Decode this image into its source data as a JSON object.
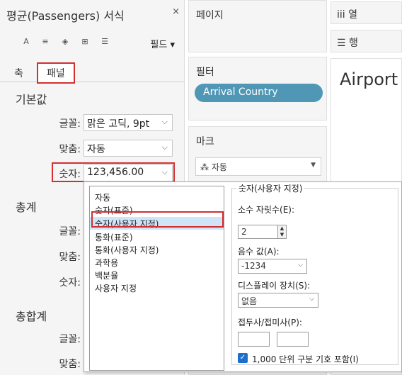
{
  "format_pane": {
    "title": "평균(Passengers) 서식",
    "close_glyph": "×",
    "toolbar": {
      "icons": [
        "font-icon",
        "align-icon",
        "shading-icon",
        "borders-icon",
        "lines-icon"
      ],
      "glyphs": [
        "A",
        "≡",
        "◈",
        "⊞",
        "☰"
      ],
      "fields_label": "필드",
      "fields_caret": "▾"
    },
    "tabs": {
      "axis": "축",
      "panel": "패널"
    },
    "default_section": {
      "title": "기본값",
      "font_label": "글꼴:",
      "font_value": "맑은 고딕, 9pt",
      "align_label": "맞춤:",
      "align_value": "자동",
      "number_label": "숫자:",
      "number_value": "123,456.00"
    },
    "totals_section": {
      "title": "총계",
      "font_label": "글꼴:",
      "align_label": "맞춤:",
      "number_label": "숫자:"
    },
    "grand_totals_section": {
      "title": "총합계",
      "font_label": "글꼴:",
      "align_label": "맞춤:"
    }
  },
  "shelves": {
    "pages": "페이지",
    "filters": "필터",
    "filter_pill": "Arrival Country",
    "marks": "마크",
    "mark_type": "자동",
    "columns": "iii 열",
    "rows": "☰ 행"
  },
  "view": {
    "title": "Airport"
  },
  "number_format_popup": {
    "list_items": [
      "자동",
      "숫자(표준)",
      "숫자(사용자 지정)",
      "통화(표준)",
      "통화(사용자 지정)",
      "과학용",
      "백분율",
      "사용자 지정"
    ],
    "selected_index": 2,
    "group_title": "숫자(사용자 지정)",
    "decimal_label": "소수 자릿수(E):",
    "decimal_value": "2",
    "negative_label": "음수 값(A):",
    "negative_value": "-1234",
    "display_units_label": "디스플레이 장치(S):",
    "display_units_value": "없음",
    "prefix_suffix_label": "접두사/접미사(P):",
    "separator_label": "1,000 단위 구분 기호 포함(I)",
    "separator_checked": true
  }
}
